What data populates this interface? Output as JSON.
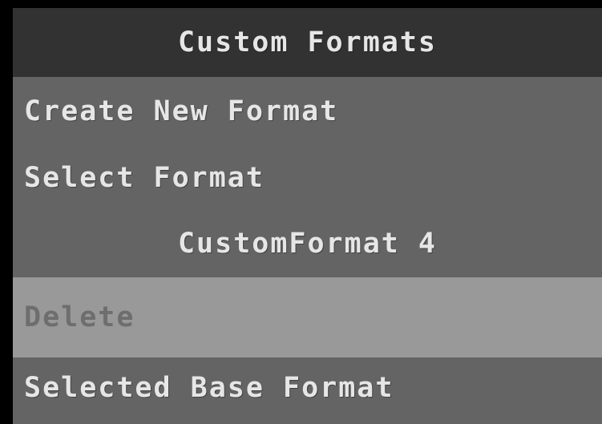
{
  "window": {
    "title": "Custom Formats"
  },
  "menu": {
    "create_new": "Create New Format",
    "select_format": "Select Format",
    "selected_format_name": "CustomFormat 4",
    "delete": "Delete",
    "selected_base_format": "Selected Base Format"
  },
  "colors": {
    "title_bar": "#323232",
    "panel": "#646464",
    "highlight": "#999999",
    "text": "#e6e6e6",
    "text_highlighted": "#6e6e6e"
  }
}
